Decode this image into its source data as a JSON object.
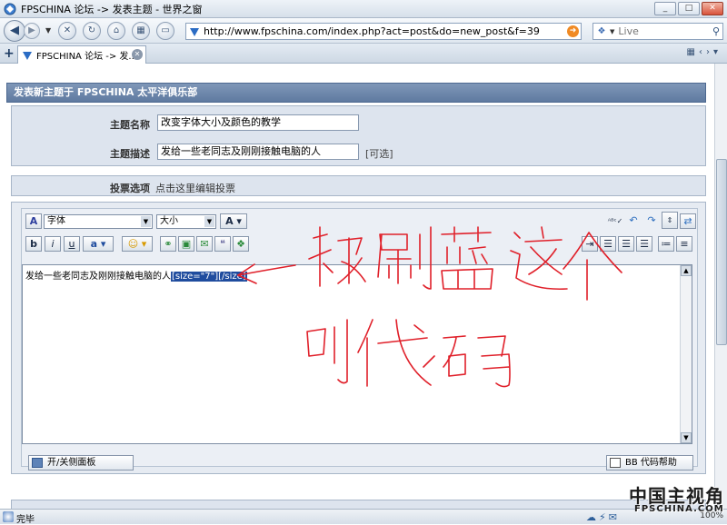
{
  "window": {
    "title": "FPSCHINA 论坛 -> 发表主题 - 世界之窗",
    "minimize_label": "_",
    "maximize_label": "□",
    "close_label": "✕"
  },
  "navbar": {
    "back_icon": "back-arrow-icon",
    "forward_icon": "forward-arrow-icon",
    "url": "http://www.fpschina.com/index.php?act=post&do=new_post&f=39",
    "search_placeholder": "Live"
  },
  "tabs": [
    {
      "label": "FPSCHINA 论坛 -> 发..."
    }
  ],
  "form": {
    "header": "发表新主题于 FPSCHINA 太平洋俱乐部",
    "topic_name_label": "主题名称",
    "topic_name_value": "改变字体大小及颜色的教学",
    "topic_desc_label": "主题描述",
    "topic_desc_value": "发给一些老同志及刚刚接触电脑的人",
    "optional_label": "[可选]",
    "poll_label": "投票选项",
    "poll_link": "点击这里编辑投票"
  },
  "editor": {
    "font_select": "字体",
    "size_select": "大小",
    "text_before": "发给一些老同志及刚刚接触电脑的人",
    "text_selected": "[size=\"7\"][/size]",
    "panel_toggle_label": "开/关侧面板",
    "bbcode_help_label": "BB 代码帮助"
  },
  "annotation": {
    "line1": "被刷蓝这个",
    "line2": "叫代码"
  },
  "status": {
    "text": "完毕",
    "zoom": "100%"
  },
  "watermark": {
    "main": "中国主视角",
    "sub": "FPSCHINA.COM"
  },
  "colors": {
    "header_bg": "#6c86ab",
    "panel_bg": "#dde4ee",
    "selection": "#1f4c9e",
    "annotation": "#e0202a"
  }
}
